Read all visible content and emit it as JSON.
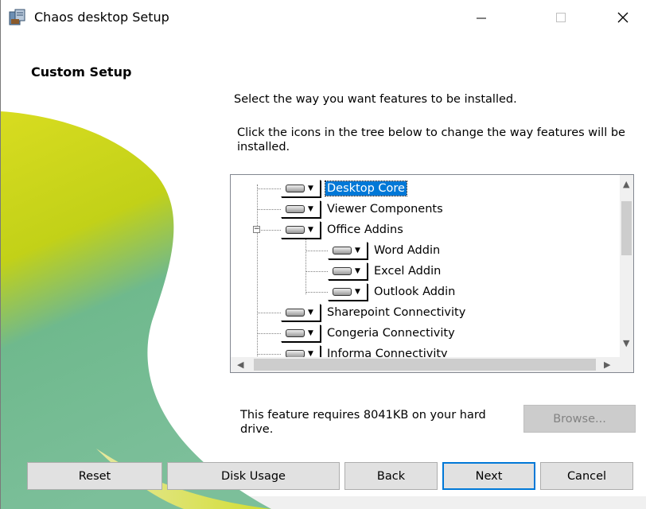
{
  "window": {
    "title": "Chaos desktop Setup",
    "icon": "installer-icon"
  },
  "header": {
    "heading": "Custom Setup"
  },
  "instructions": {
    "line1": "Select the way you want features to be installed.",
    "line2": "Click the icons in the tree below to change the way features will be installed."
  },
  "tree": {
    "nodes": [
      {
        "label": "Desktop Core",
        "selected": true
      },
      {
        "label": "Viewer Components"
      },
      {
        "label": "Office Addins",
        "expanded": true
      },
      {
        "label": "Word Addin"
      },
      {
        "label": "Excel Addin"
      },
      {
        "label": "Outlook Addin"
      },
      {
        "label": "Sharepoint Connectivity"
      },
      {
        "label": "Congeria Connectivity"
      },
      {
        "label": "Informa Connectivity"
      }
    ]
  },
  "requirement_text": "This feature requires 8041KB on your hard drive.",
  "buttons": {
    "browse": "Browse...",
    "reset": "Reset",
    "disk_usage": "Disk Usage",
    "back": "Back",
    "next": "Next",
    "cancel": "Cancel"
  },
  "colors": {
    "accent": "#0078d7",
    "decor_green": "#c8d400",
    "decor_teal": "#5fb8a0"
  }
}
